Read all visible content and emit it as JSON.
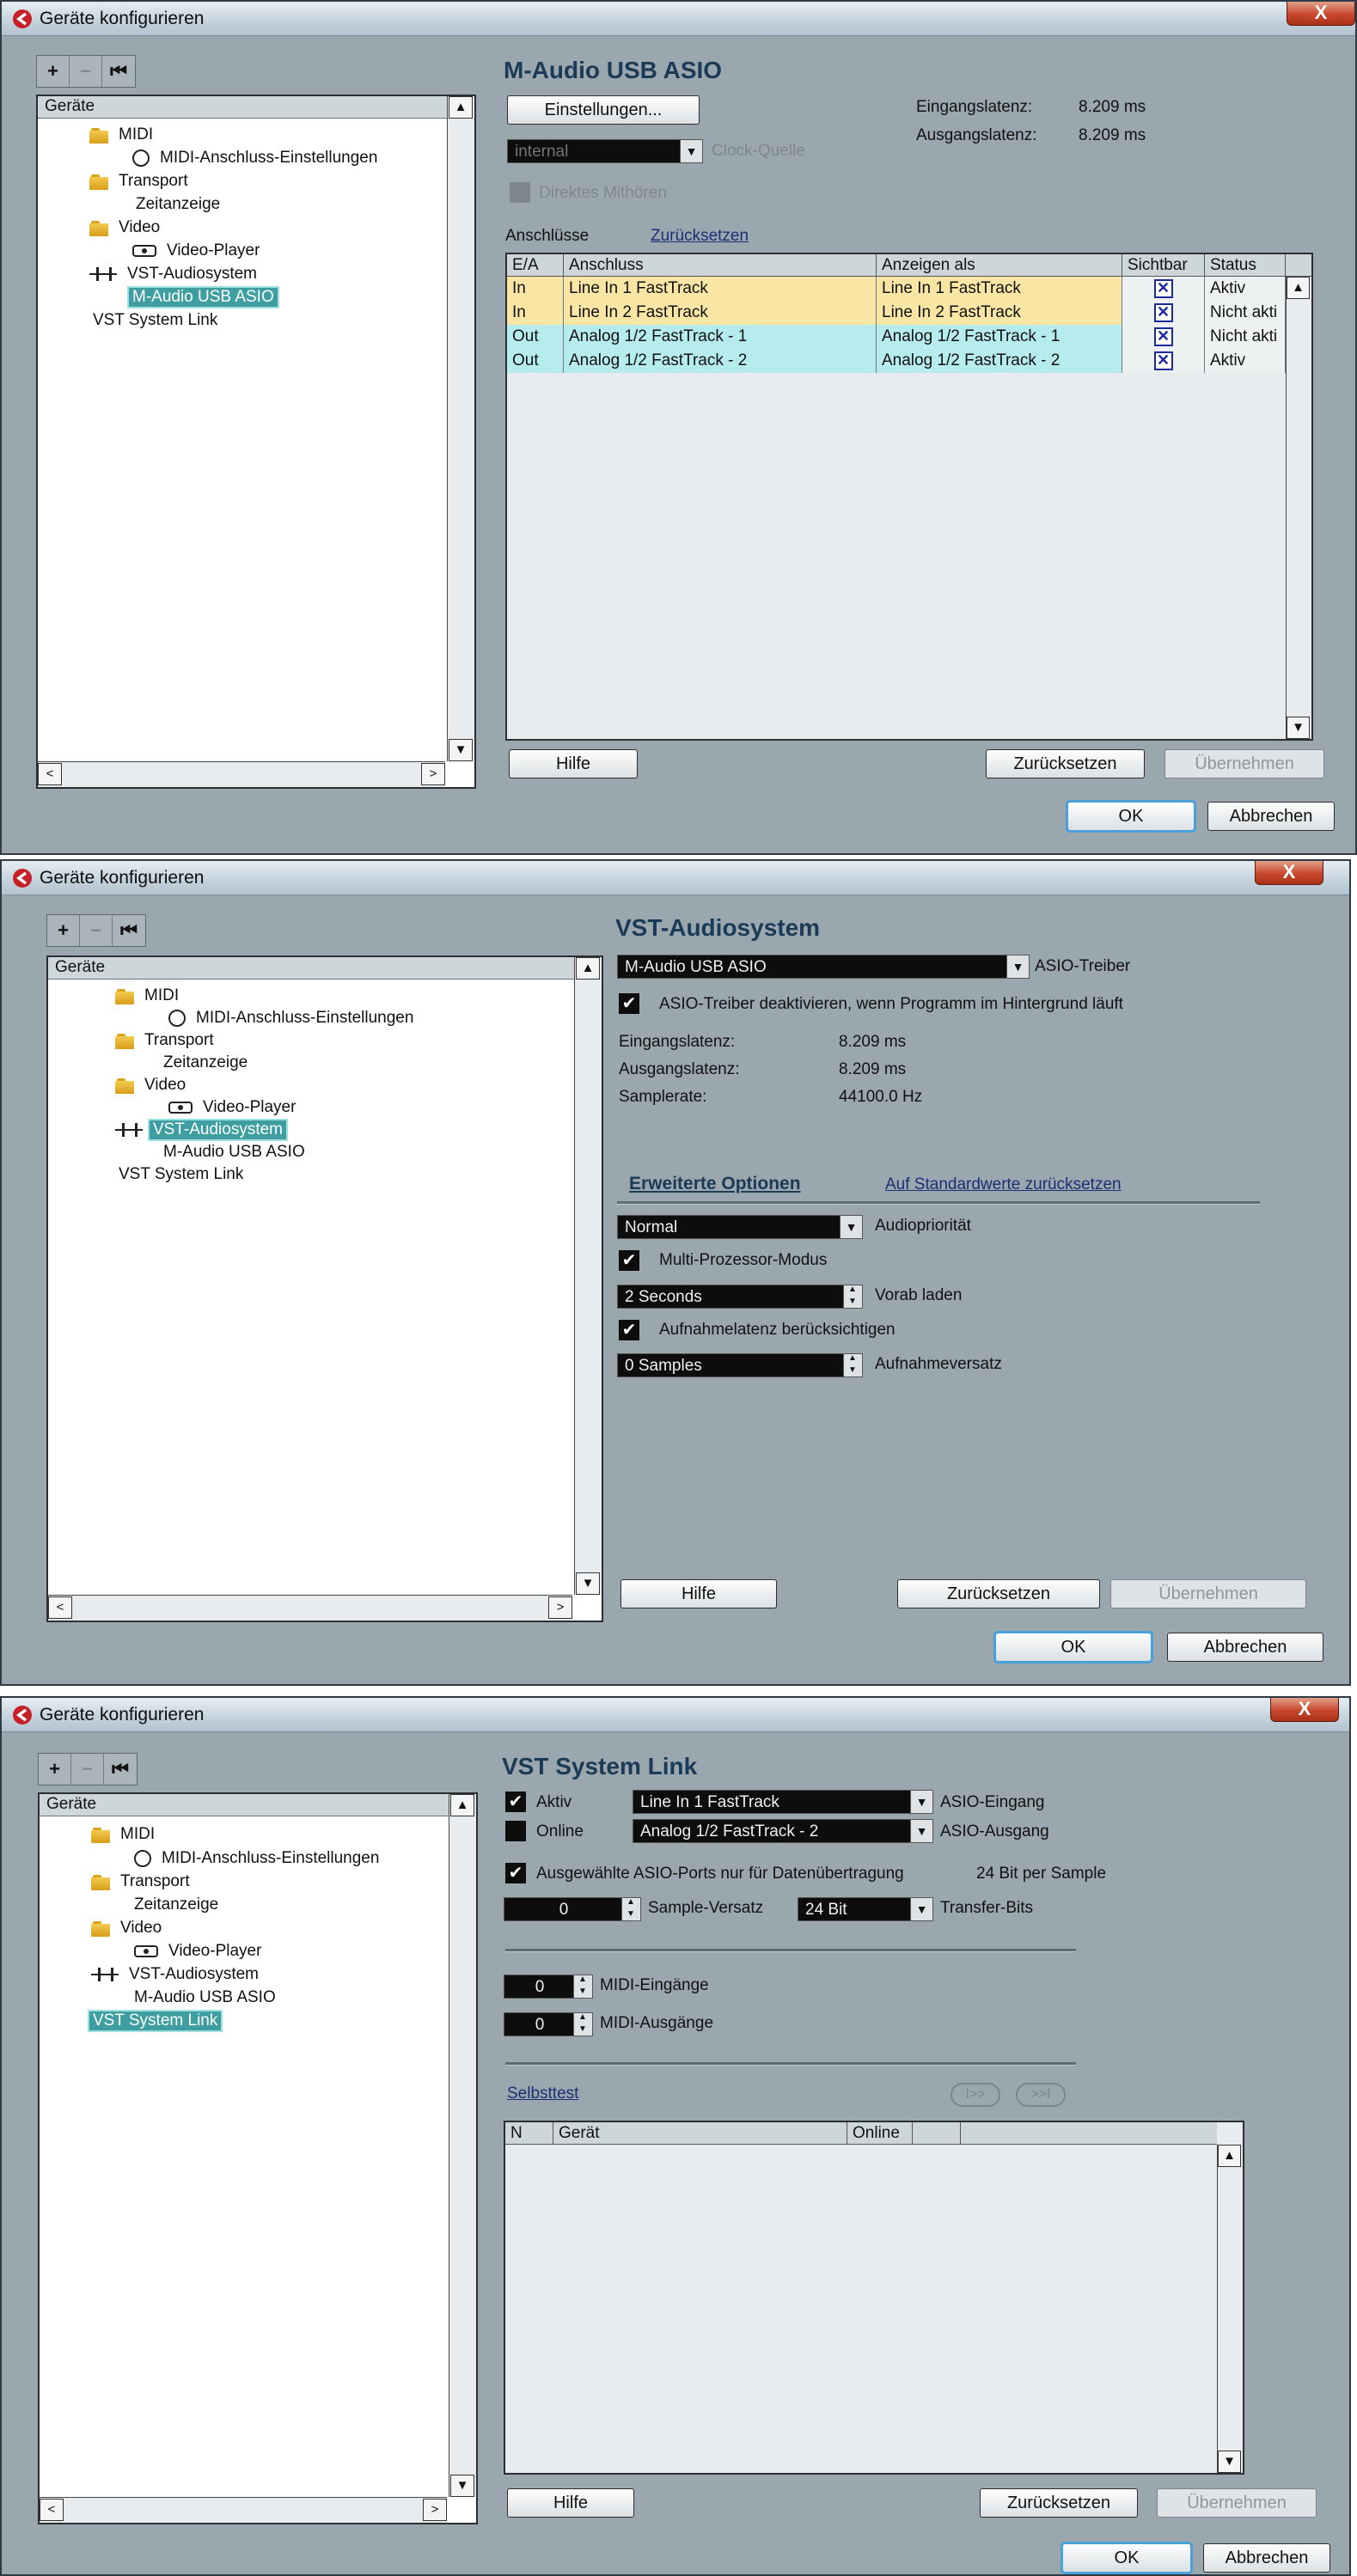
{
  "dialog_title": "Geräte konfigurieren",
  "close_label": "X",
  "toolbar": {
    "add": "+",
    "remove": "−",
    "reset": "⏮"
  },
  "tree": {
    "header": "Geräte",
    "midi": "MIDI",
    "midi_port_settings": "MIDI-Anschluss-Einstellungen",
    "transport": "Transport",
    "time_display": "Zeitanzeige",
    "video": "Video",
    "video_player": "Video-Player",
    "vst_audio": "VST-Audiosystem",
    "m_audio": "M-Audio USB ASIO",
    "vst_link": "VST System Link"
  },
  "common": {
    "help": "Hilfe",
    "reset": "Zurücksetzen",
    "apply": "Übernehmen",
    "ok": "OK",
    "cancel": "Abbrechen",
    "left_arrow": "<",
    "right_arrow": ">",
    "up_arrow": "▲",
    "down_arrow": "▼",
    "check": "✔",
    "cross": "✕"
  },
  "panel1": {
    "title": "M-Audio USB ASIO",
    "settings_button": "Einstellungen...",
    "input_latency_label": "Eingangslatenz:",
    "input_latency_value": "8.209 ms",
    "output_latency_label": "Ausgangslatenz:",
    "output_latency_value": "8.209 ms",
    "clock_value": "internal",
    "clock_label": "Clock-Quelle",
    "direct_monitor_label": "Direktes Mithören",
    "ports_label": "Anschlüsse",
    "ports_reset_link": "Zurücksetzen",
    "columns": [
      "E/A",
      "Anschluss",
      "Anzeigen als",
      "Sichtbar",
      "Status"
    ],
    "rows": [
      {
        "io": "In",
        "port": "Line In 1 FastTrack",
        "show_as": "Line In 1 FastTrack",
        "visible": true,
        "status": "Aktiv",
        "color": "#f9e6a5"
      },
      {
        "io": "In",
        "port": "Line In 2 FastTrack",
        "show_as": "Line In 2 FastTrack",
        "visible": true,
        "status": "Nicht akti",
        "color": "#f9e6a5"
      },
      {
        "io": "Out",
        "port": "Analog 1/2 FastTrack - 1",
        "show_as": "Analog 1/2 FastTrack - 1",
        "visible": true,
        "status": "Nicht akti",
        "color": "#b7ecef"
      },
      {
        "io": "Out",
        "port": "Analog 1/2 FastTrack - 2",
        "show_as": "Analog 1/2 FastTrack - 2",
        "visible": true,
        "status": "Aktiv",
        "color": "#b7ecef"
      }
    ]
  },
  "panel2": {
    "title": "VST-Audiosystem",
    "driver_value": "M-Audio USB ASIO",
    "driver_label": "ASIO-Treiber",
    "deactivate_label": "ASIO-Treiber deaktivieren, wenn Programm im Hintergrund läuft",
    "input_latency_label": "Eingangslatenz:",
    "input_latency_value": "8.209 ms",
    "output_latency_label": "Ausgangslatenz:",
    "output_latency_value": "8.209 ms",
    "samplerate_label": "Samplerate:",
    "samplerate_value": "44100.0 Hz",
    "advanced_tab": "Erweiterte Optionen",
    "defaults_link": "Auf Standardwerte zurücksetzen",
    "priority_value": "Normal",
    "priority_label": "Audiopriorität",
    "multiproc_label": "Multi-Prozessor-Modus",
    "preload_value": "2 Seconds",
    "preload_label": "Vorab laden",
    "rec_latency_label": "Aufnahmelatenz berücksichtigen",
    "rec_offset_value": "0 Samples",
    "rec_offset_label": "Aufnahmeversatz"
  },
  "panel3": {
    "title": "VST System Link",
    "active_label": "Aktiv",
    "active_value": "Line In 1 FastTrack",
    "asio_in_label": "ASIO-Eingang",
    "online_label": "Online",
    "online_value": "Analog 1/2 FastTrack - 2",
    "asio_out_label": "ASIO-Ausgang",
    "data_only_label": "Ausgewählte ASIO-Ports nur für Datenübertragung",
    "bits_per_sample": "24 Bit per Sample",
    "sample_offset_value": "0",
    "sample_offset_label": "Sample-Versatz",
    "transfer_bits_value": "24 Bit",
    "transfer_bits_label": "Transfer-Bits",
    "midi_in_value": "0",
    "midi_in_label": "MIDI-Eingänge",
    "midi_out_value": "0",
    "midi_out_label": "MIDI-Ausgänge",
    "selftest_link": "Selbsttest",
    "btn_a": "I>>",
    "btn_b": ">>I",
    "columns": [
      "N",
      "Gerät",
      "Online"
    ]
  }
}
